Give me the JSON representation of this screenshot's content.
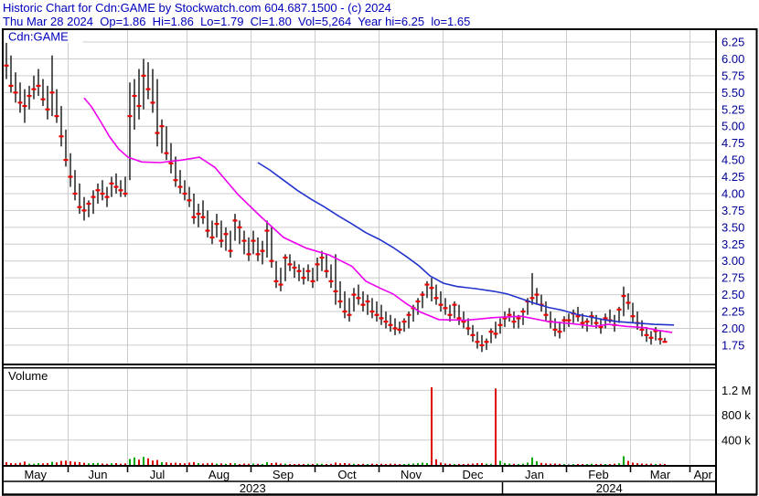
{
  "header": {
    "title": "Historic Chart for Cdn:GAME by Stockwatch.com 604.687.1500 - (c) 2024",
    "quote": "Thu Mar 28 2024  Op=1.86  Hi=1.86  Lo=1.79  Cl=1.80  Vol=5,264  Year hi=6.25  lo=1.65"
  },
  "chart": {
    "symbol": "Cdn:GAME",
    "volume_label": "Volume"
  },
  "colors": {
    "header_text": "#0000bb",
    "symbol_text": "#0000bb",
    "volume_label_text": "#000000",
    "price_label": "#000099",
    "axis_text": "#000000",
    "grid": "#cccccc",
    "border": "#000000",
    "bar": "#000000",
    "close_tick": "#ee0000",
    "ma_short": "#ee00ee",
    "ma_long": "#2233cc",
    "volume_up": "#00aa00",
    "volume_down": "#dd0000",
    "volume_flat": "#999999"
  },
  "chart_data": {
    "type": "ohlc-volume",
    "title": "Historic Chart for Cdn:GAME",
    "symbol": "Cdn:GAME",
    "y_axis": {
      "min": 1.7,
      "max": 6.3,
      "tick_step": 0.25,
      "ticks": [
        6.25,
        6.0,
        5.75,
        5.5,
        5.25,
        5.0,
        4.75,
        4.5,
        4.25,
        4.0,
        3.75,
        3.5,
        3.25,
        3.0,
        2.75,
        2.5,
        2.25,
        2.0,
        1.75
      ]
    },
    "volume_axis": {
      "unit": "thousands",
      "ticks": [
        {
          "label": "1.2 M",
          "value": 1200
        },
        {
          "label": "800 k",
          "value": 800
        },
        {
          "label": "400 k",
          "value": 400
        }
      ]
    },
    "months": [
      {
        "label": "May",
        "start": 0,
        "end": 14
      },
      {
        "label": "Jun",
        "start": 14,
        "end": 27
      },
      {
        "label": "Jul",
        "start": 27,
        "end": 40
      },
      {
        "label": "Aug",
        "start": 40,
        "end": 54
      },
      {
        "label": "Sep",
        "start": 54,
        "end": 68
      },
      {
        "label": "Oct",
        "start": 68,
        "end": 82
      },
      {
        "label": "Nov",
        "start": 82,
        "end": 96
      },
      {
        "label": "Dec",
        "start": 96,
        "end": 109
      },
      {
        "label": "Jan",
        "start": 109,
        "end": 123
      },
      {
        "label": "Feb",
        "start": 123,
        "end": 137
      },
      {
        "label": "Mar",
        "start": 137,
        "end": 150
      },
      {
        "label": "Apr",
        "start": 150,
        "end": 156
      }
    ],
    "years": [
      {
        "label": "2023",
        "start": 0,
        "end": 109
      },
      {
        "label": "2024",
        "start": 109,
        "end": 156
      }
    ],
    "bar_fields": [
      "high",
      "low",
      "close",
      "volume_thousands"
    ],
    "bars": [
      [
        6.25,
        5.7,
        5.9,
        45
      ],
      [
        6.05,
        5.5,
        5.6,
        30
      ],
      [
        5.8,
        5.35,
        5.5,
        25
      ],
      [
        5.65,
        5.2,
        5.35,
        35
      ],
      [
        5.55,
        5.05,
        5.3,
        55
      ],
      [
        5.6,
        5.25,
        5.45,
        20
      ],
      [
        5.75,
        5.4,
        5.55,
        18
      ],
      [
        5.85,
        5.45,
        5.6,
        28
      ],
      [
        5.7,
        5.3,
        5.4,
        25
      ],
      [
        5.6,
        5.1,
        5.25,
        30
      ],
      [
        6.05,
        5.15,
        5.5,
        50
      ],
      [
        5.55,
        5.05,
        5.15,
        40
      ],
      [
        5.3,
        4.7,
        4.85,
        65
      ],
      [
        4.95,
        4.4,
        4.5,
        70
      ],
      [
        4.6,
        4.1,
        4.25,
        60
      ],
      [
        4.35,
        3.9,
        4.0,
        50
      ],
      [
        4.15,
        3.7,
        3.8,
        45
      ],
      [
        3.95,
        3.6,
        3.75,
        35
      ],
      [
        3.9,
        3.65,
        3.85,
        25
      ],
      [
        4.05,
        3.7,
        3.95,
        30
      ],
      [
        4.15,
        3.85,
        4.05,
        32
      ],
      [
        4.2,
        3.9,
        4.0,
        22
      ],
      [
        4.1,
        3.8,
        3.95,
        18
      ],
      [
        4.25,
        3.95,
        4.15,
        26
      ],
      [
        4.3,
        4.0,
        4.1,
        30
      ],
      [
        4.2,
        3.95,
        4.05,
        20
      ],
      [
        4.25,
        3.95,
        4.0,
        24
      ],
      [
        5.65,
        4.2,
        5.15,
        95
      ],
      [
        5.7,
        4.95,
        5.45,
        120
      ],
      [
        5.85,
        5.1,
        5.3,
        85
      ],
      [
        6.0,
        5.25,
        5.75,
        130
      ],
      [
        5.95,
        5.4,
        5.55,
        105
      ],
      [
        5.85,
        5.2,
        5.35,
        70
      ],
      [
        5.7,
        4.7,
        4.9,
        80
      ],
      [
        5.1,
        4.6,
        5.0,
        45
      ],
      [
        5.0,
        4.5,
        4.6,
        40
      ],
      [
        4.75,
        4.3,
        4.45,
        32
      ],
      [
        4.55,
        4.1,
        4.2,
        36
      ],
      [
        4.35,
        4.0,
        4.1,
        28
      ],
      [
        4.2,
        3.9,
        4.0,
        26
      ],
      [
        4.1,
        3.8,
        3.9,
        38
      ],
      [
        4.0,
        3.55,
        3.65,
        45
      ],
      [
        3.85,
        3.5,
        3.7,
        30
      ],
      [
        3.9,
        3.55,
        3.65,
        22
      ],
      [
        3.75,
        3.35,
        3.45,
        26
      ],
      [
        3.6,
        3.25,
        3.35,
        32
      ],
      [
        3.7,
        3.35,
        3.55,
        20
      ],
      [
        3.6,
        3.2,
        3.3,
        24
      ],
      [
        3.5,
        3.15,
        3.4,
        18
      ],
      [
        3.45,
        3.05,
        3.15,
        30
      ],
      [
        3.7,
        3.3,
        3.6,
        26
      ],
      [
        3.6,
        3.25,
        3.5,
        15
      ],
      [
        3.45,
        3.1,
        3.3,
        22
      ],
      [
        3.35,
        3.0,
        3.1,
        18
      ],
      [
        3.45,
        3.1,
        3.3,
        22
      ],
      [
        3.35,
        3.0,
        3.1,
        18
      ],
      [
        3.3,
        2.95,
        3.15,
        15
      ],
      [
        3.6,
        3.05,
        3.45,
        45
      ],
      [
        3.5,
        2.9,
        3.0,
        30
      ],
      [
        3.0,
        2.6,
        2.7,
        38
      ],
      [
        2.9,
        2.55,
        2.65,
        22
      ],
      [
        3.1,
        2.7,
        3.05,
        20
      ],
      [
        3.1,
        2.85,
        2.95,
        15
      ],
      [
        3.0,
        2.75,
        2.9,
        13
      ],
      [
        2.95,
        2.7,
        2.85,
        16
      ],
      [
        2.9,
        2.65,
        2.75,
        15
      ],
      [
        2.95,
        2.7,
        2.85,
        18
      ],
      [
        2.9,
        2.6,
        2.7,
        15
      ],
      [
        3.05,
        2.7,
        2.95,
        20
      ],
      [
        3.15,
        2.85,
        3.05,
        18
      ],
      [
        3.1,
        2.75,
        2.85,
        15
      ],
      [
        2.95,
        2.6,
        2.7,
        18
      ],
      [
        3.1,
        2.35,
        2.55,
        38
      ],
      [
        2.7,
        2.3,
        2.4,
        26
      ],
      [
        2.55,
        2.15,
        2.25,
        30
      ],
      [
        2.45,
        2.1,
        2.2,
        22
      ],
      [
        2.6,
        2.25,
        2.5,
        18
      ],
      [
        2.65,
        2.35,
        2.45,
        15
      ],
      [
        2.55,
        2.25,
        2.35,
        18
      ],
      [
        2.5,
        2.2,
        2.4,
        14
      ],
      [
        2.45,
        2.15,
        2.25,
        19
      ],
      [
        2.4,
        2.1,
        2.2,
        16
      ],
      [
        2.35,
        2.05,
        2.15,
        18
      ],
      [
        2.25,
        2.0,
        2.1,
        15
      ],
      [
        2.2,
        1.95,
        2.05,
        20
      ],
      [
        2.15,
        1.9,
        2.0,
        18
      ],
      [
        2.1,
        1.92,
        1.98,
        14
      ],
      [
        2.15,
        1.95,
        2.1,
        13
      ],
      [
        2.25,
        2.0,
        2.2,
        18
      ],
      [
        2.35,
        2.1,
        2.3,
        22
      ],
      [
        2.45,
        2.2,
        2.4,
        28
      ],
      [
        2.55,
        2.3,
        2.5,
        38
      ],
      [
        2.7,
        2.45,
        2.65,
        30
      ],
      [
        2.75,
        2.4,
        2.6,
        1250
      ],
      [
        2.65,
        2.35,
        2.45,
        90
      ],
      [
        2.55,
        2.25,
        2.35,
        38
      ],
      [
        2.45,
        2.2,
        2.3,
        22
      ],
      [
        2.35,
        2.1,
        2.2,
        18
      ],
      [
        2.4,
        2.15,
        2.35,
        15
      ],
      [
        2.35,
        2.05,
        2.15,
        16
      ],
      [
        2.25,
        2.0,
        2.1,
        14
      ],
      [
        2.15,
        1.9,
        2.0,
        18
      ],
      [
        2.05,
        1.8,
        1.9,
        22
      ],
      [
        1.95,
        1.7,
        1.8,
        28
      ],
      [
        1.9,
        1.65,
        1.75,
        30
      ],
      [
        1.85,
        1.68,
        1.8,
        20
      ],
      [
        2.0,
        1.78,
        1.95,
        18
      ],
      [
        2.1,
        1.85,
        1.92,
        1230
      ],
      [
        2.15,
        1.92,
        2.05,
        65
      ],
      [
        2.25,
        2.02,
        2.15,
        30
      ],
      [
        2.3,
        2.1,
        2.2,
        22
      ],
      [
        2.25,
        2.0,
        2.1,
        18
      ],
      [
        2.2,
        2.0,
        2.15,
        15
      ],
      [
        2.3,
        2.05,
        2.25,
        20
      ],
      [
        2.45,
        2.2,
        2.4,
        38
      ],
      [
        2.82,
        2.35,
        2.45,
        120
      ],
      [
        2.6,
        2.35,
        2.5,
        60
      ],
      [
        2.5,
        2.25,
        2.35,
        32
      ],
      [
        2.4,
        2.1,
        2.2,
        24
      ],
      [
        2.25,
        2.0,
        2.1,
        20
      ],
      [
        2.15,
        1.88,
        1.98,
        22
      ],
      [
        2.1,
        1.85,
        1.95,
        18
      ],
      [
        2.18,
        1.95,
        2.12,
        14
      ],
      [
        2.22,
        2.02,
        2.12,
        18
      ],
      [
        2.28,
        2.08,
        2.22,
        13
      ],
      [
        2.32,
        2.1,
        2.18,
        16
      ],
      [
        2.22,
        2.0,
        2.08,
        12
      ],
      [
        2.15,
        1.95,
        2.1,
        15
      ],
      [
        2.25,
        2.05,
        2.18,
        18
      ],
      [
        2.2,
        2.0,
        2.08,
        13
      ],
      [
        2.15,
        1.92,
        2.02,
        16
      ],
      [
        2.22,
        2.0,
        2.15,
        12
      ],
      [
        2.28,
        2.08,
        2.12,
        15
      ],
      [
        2.2,
        1.95,
        2.05,
        19
      ],
      [
        2.32,
        2.08,
        2.28,
        28
      ],
      [
        2.62,
        2.18,
        2.48,
        140
      ],
      [
        2.52,
        2.28,
        2.38,
        65
      ],
      [
        2.38,
        2.08,
        2.18,
        38
      ],
      [
        2.25,
        1.98,
        2.08,
        28
      ],
      [
        2.12,
        1.88,
        1.98,
        22
      ],
      [
        2.02,
        1.8,
        1.9,
        18
      ],
      [
        1.96,
        1.76,
        1.86,
        20
      ],
      [
        2.02,
        1.82,
        1.96,
        15
      ],
      [
        1.96,
        1.76,
        1.84,
        18
      ],
      [
        1.86,
        1.79,
        1.8,
        5.3
      ]
    ],
    "moving_averages": [
      {
        "name": "ma-short-magenta",
        "color_key": "ma_short",
        "points": [
          [
            17,
            5.42
          ],
          [
            18.6,
            5.29
          ],
          [
            20.6,
            5.07
          ],
          [
            22.6,
            4.84
          ],
          [
            24.6,
            4.66
          ],
          [
            26.6,
            4.54
          ],
          [
            29.6,
            4.47
          ],
          [
            33.6,
            4.46
          ],
          [
            38.6,
            4.5
          ],
          [
            42.2,
            4.54
          ],
          [
            45.6,
            4.39
          ],
          [
            50.6,
            3.99
          ],
          [
            55.6,
            3.66
          ],
          [
            60.6,
            3.35
          ],
          [
            65.6,
            3.19
          ],
          [
            70.6,
            3.09
          ],
          [
            75.6,
            2.92
          ],
          [
            78.6,
            2.7
          ],
          [
            81.6,
            2.6
          ],
          [
            84.6,
            2.51
          ],
          [
            87.6,
            2.36
          ],
          [
            90.6,
            2.24
          ],
          [
            94.6,
            2.13
          ],
          [
            100.6,
            2.12
          ],
          [
            106.6,
            2.16
          ],
          [
            112.6,
            2.18
          ],
          [
            118.6,
            2.1
          ],
          [
            123.6,
            2.07
          ],
          [
            128.6,
            2.03
          ],
          [
            131.6,
            2.06
          ],
          [
            135.6,
            2.03
          ],
          [
            139.6,
            2.01
          ],
          [
            142.6,
            1.97
          ],
          [
            145.6,
            1.94
          ]
        ]
      },
      {
        "name": "ma-long-blue",
        "color_key": "ma_long",
        "points": [
          [
            55,
            4.46
          ],
          [
            57.6,
            4.35
          ],
          [
            60.6,
            4.2
          ],
          [
            63.6,
            4.05
          ],
          [
            66.6,
            3.92
          ],
          [
            69.6,
            3.8
          ],
          [
            72.6,
            3.67
          ],
          [
            75.6,
            3.55
          ],
          [
            78.6,
            3.42
          ],
          [
            81.6,
            3.32
          ],
          [
            84.6,
            3.2
          ],
          [
            87.6,
            3.06
          ],
          [
            90.2,
            2.93
          ],
          [
            92.6,
            2.78
          ],
          [
            95.6,
            2.67
          ],
          [
            98.6,
            2.62
          ],
          [
            102.6,
            2.59
          ],
          [
            106.6,
            2.55
          ],
          [
            109.6,
            2.51
          ],
          [
            112.6,
            2.44
          ],
          [
            115.6,
            2.37
          ],
          [
            118.6,
            2.31
          ],
          [
            121.6,
            2.27
          ],
          [
            124.6,
            2.21
          ],
          [
            127.6,
            2.17
          ],
          [
            130.6,
            2.13
          ],
          [
            133.6,
            2.1
          ],
          [
            137.6,
            2.08
          ],
          [
            141.6,
            2.06
          ],
          [
            146,
            2.05
          ]
        ]
      }
    ]
  }
}
